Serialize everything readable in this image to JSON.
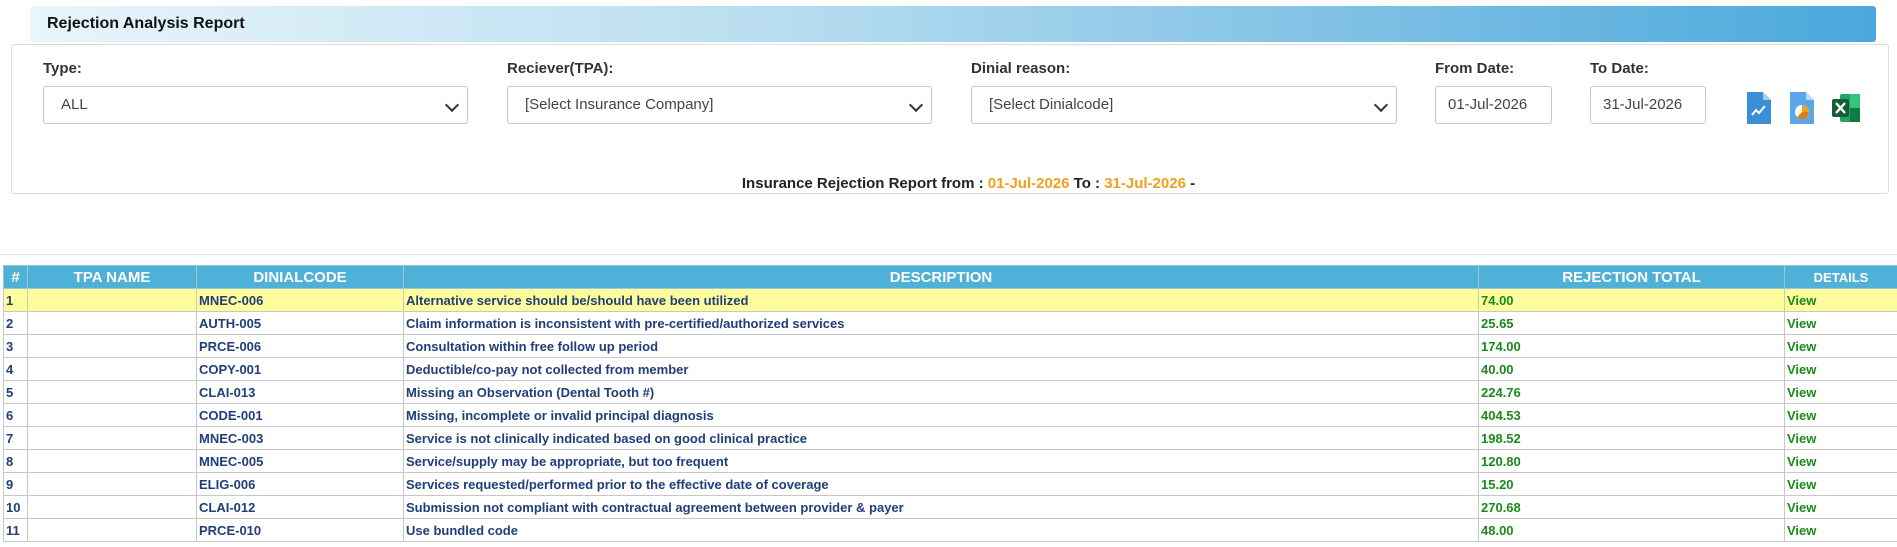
{
  "header": {
    "title": "Rejection Analysis Report"
  },
  "filters": {
    "type": {
      "label": "Type:",
      "value": "ALL"
    },
    "receiver": {
      "label": "Reciever(TPA):",
      "value": "[Select Insurance Company]"
    },
    "reason": {
      "label": "Dinial reason:",
      "value": "[Select Dinialcode]"
    },
    "from_date": {
      "label": "From Date:",
      "value": "01-Jul-2026"
    },
    "to_date": {
      "label": "To Date:",
      "value": "31-Jul-2026"
    }
  },
  "toolbar": {
    "icons": [
      "line-chart-file-icon",
      "pie-chart-file-icon",
      "excel-export-icon"
    ],
    "colors": {
      "chart_icon": "#3b8fd9",
      "excel_icon": "#1d7044"
    }
  },
  "summary": {
    "prefix": "Insurance Rejection Report from : ",
    "from": "01-Jul-2026",
    "mid": " To : ",
    "to": "31-Jul-2026",
    "suffix": " -"
  },
  "table": {
    "columns": [
      "#",
      "TPA NAME",
      "DINIALCODE",
      "DESCRIPTION",
      "REJECTION TOTAL",
      "DETAILS"
    ],
    "rows": [
      {
        "num": "1",
        "tpa": "",
        "code": "MNEC-006",
        "desc": "Alternative service should be/should have been utilized",
        "total": "74.00",
        "details": "View"
      },
      {
        "num": "2",
        "tpa": "",
        "code": "AUTH-005",
        "desc": "Claim information is inconsistent with pre-certified/authorized services",
        "total": "25.65",
        "details": "View"
      },
      {
        "num": "3",
        "tpa": "",
        "code": "PRCE-006",
        "desc": "Consultation within free follow up period",
        "total": "174.00",
        "details": "View"
      },
      {
        "num": "4",
        "tpa": "",
        "code": "COPY-001",
        "desc": "Deductible/co-pay not collected from member",
        "total": "40.00",
        "details": "View"
      },
      {
        "num": "5",
        "tpa": "",
        "code": "CLAI-013",
        "desc": "Missing an Observation (Dental Tooth #)",
        "total": "224.76",
        "details": "View"
      },
      {
        "num": "6",
        "tpa": "",
        "code": "CODE-001",
        "desc": "Missing, incomplete or invalid principal diagnosis",
        "total": "404.53",
        "details": "View"
      },
      {
        "num": "7",
        "tpa": "",
        "code": "MNEC-003",
        "desc": "Service is not clinically indicated based on good clinical practice",
        "total": "198.52",
        "details": "View"
      },
      {
        "num": "8",
        "tpa": "",
        "code": "MNEC-005",
        "desc": "Service/supply may be appropriate, but too frequent",
        "total": "120.80",
        "details": "View"
      },
      {
        "num": "9",
        "tpa": "",
        "code": "ELIG-006",
        "desc": "Services requested/performed prior to the effective date of coverage",
        "total": "15.20",
        "details": "View"
      },
      {
        "num": "10",
        "tpa": "",
        "code": "CLAI-012",
        "desc": "Submission not compliant with contractual agreement between provider & payer",
        "total": "270.68",
        "details": "View"
      },
      {
        "num": "11",
        "tpa": "",
        "code": "PRCE-010",
        "desc": "Use bundled code",
        "total": "48.00",
        "details": "View"
      }
    ]
  }
}
